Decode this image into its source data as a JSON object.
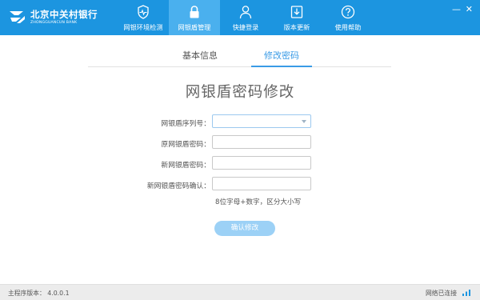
{
  "header": {
    "logo": {
      "name_cn": "北京中关村银行",
      "name_en": "ZHONGGUANCUN BANK"
    },
    "nav": [
      {
        "id": "env-check",
        "label": "网银环境检测",
        "icon": "shield-pulse-icon"
      },
      {
        "id": "shield-manage",
        "label": "网银盾管理",
        "icon": "lock-icon",
        "active": true
      },
      {
        "id": "quick-login",
        "label": "快捷登录",
        "icon": "user-icon"
      },
      {
        "id": "update",
        "label": "版本更新",
        "icon": "download-icon"
      },
      {
        "id": "help",
        "label": "使用帮助",
        "icon": "question-circle-icon"
      }
    ],
    "window_controls": {
      "minimize": "—",
      "close": "✕"
    }
  },
  "tabs": {
    "basic_info": "基本信息",
    "change_password": "修改密码",
    "active": "change_password"
  },
  "form": {
    "title": "网银盾密码修改",
    "serial_label": "网银盾序列号：",
    "serial_value": "",
    "old_password_label": "原网银盾密码：",
    "new_password_label": "新网银盾密码：",
    "confirm_password_label": "新网银盾密码确认：",
    "hint": "8位字母+数字，区分大小写",
    "submit_label": "确认修改"
  },
  "status_bar": {
    "version_label": "主程序版本：",
    "version": "4.0.0.1",
    "network": "网络已连接"
  },
  "colors": {
    "brand": "#1c95e0",
    "nav_active": "#4ab0ee",
    "accent": "#3a9be6",
    "button": "#9cd1f6"
  }
}
